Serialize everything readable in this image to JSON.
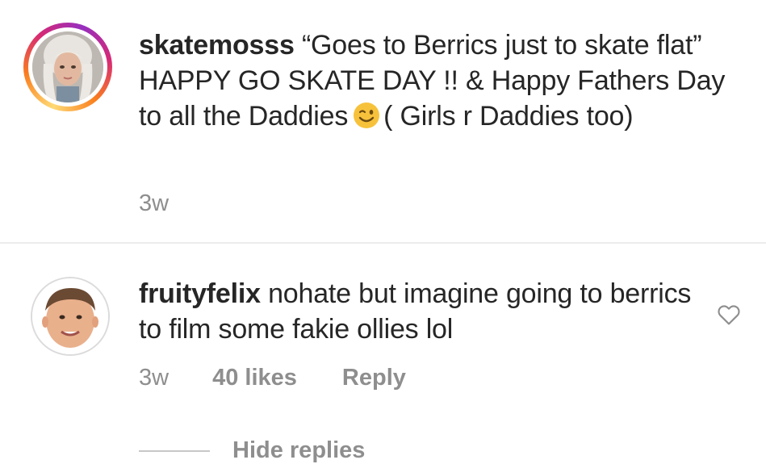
{
  "caption": {
    "username": "skatemosss",
    "text_before_emoji": "“Goes to Berrics just to skate flat”  HAPPY GO SKATE DAY !! & Happy Fathers Day to all the Daddies",
    "emoji": "winking-face",
    "text_after_emoji": "( Girls r Daddies too)",
    "time": "3w",
    "avatar": "profile-photo"
  },
  "reply": {
    "username": "fruityfelix",
    "text": "nohate but imagine going to berrics to film some fakie ollies lol",
    "time": "3w",
    "likes": "40 likes",
    "reply_label": "Reply",
    "avatar": "profile-photo",
    "like_icon": "heart-outline-icon"
  },
  "thread": {
    "hide_replies_label": "Hide replies"
  },
  "colors": {
    "text": "#262626",
    "secondary": "#8e8e8e",
    "divider": "#ececec"
  }
}
